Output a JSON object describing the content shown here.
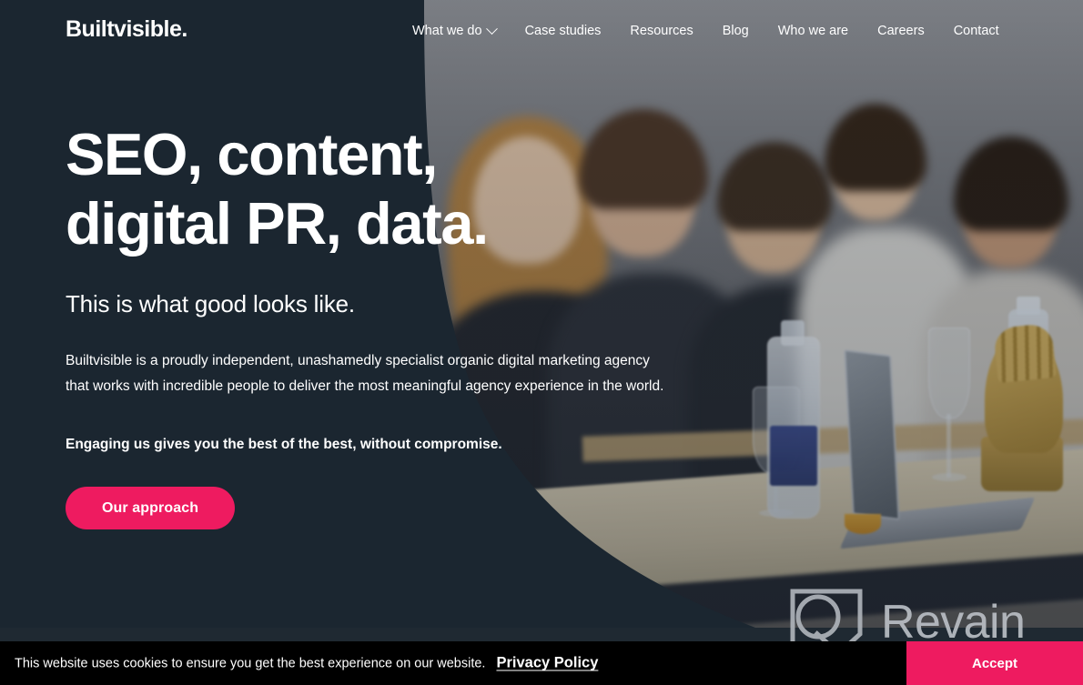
{
  "site": {
    "logo": "Builtvisible."
  },
  "nav": {
    "items": [
      {
        "label": "What we do",
        "has_chevron": true,
        "icon": "chevron-down-icon"
      },
      {
        "label": "Case studies",
        "has_chevron": false
      },
      {
        "label": "Resources",
        "has_chevron": false
      },
      {
        "label": "Blog",
        "has_chevron": false
      },
      {
        "label": "Who we are",
        "has_chevron": false
      },
      {
        "label": "Careers",
        "has_chevron": false
      },
      {
        "label": "Contact",
        "has_chevron": false
      }
    ]
  },
  "hero": {
    "headline": "SEO, content,\ndigital PR, data.",
    "headline_line1": "SEO, content,",
    "headline_line2": "digital PR, data.",
    "subheadline": "This is what good looks like.",
    "paragraph": "Builtvisible is a proudly independent, unashamedly specialist organic digital marketing agency that works with incredible people to deliver the most meaningful agency experience in the world.",
    "emphasis": "Engaging us gives you the best of the best, without compromise.",
    "cta_label": "Our approach",
    "image_alt": "Team of people seated at a table with a laptop, water bottle, wine glasses and a gold hand trophy"
  },
  "watermark": {
    "text": "Revain",
    "icon": "revain-logo-icon"
  },
  "cookie_banner": {
    "message": "This website uses cookies to ensure you get the best experience on our website.",
    "policy_link": "Privacy Policy",
    "accept_label": "Accept"
  },
  "colors": {
    "background_dark": "#1b2630",
    "accent_pink": "#ee1b60",
    "banner_black": "#000000",
    "text_white": "#ffffff",
    "watermark_gray": "#b9bec4"
  }
}
